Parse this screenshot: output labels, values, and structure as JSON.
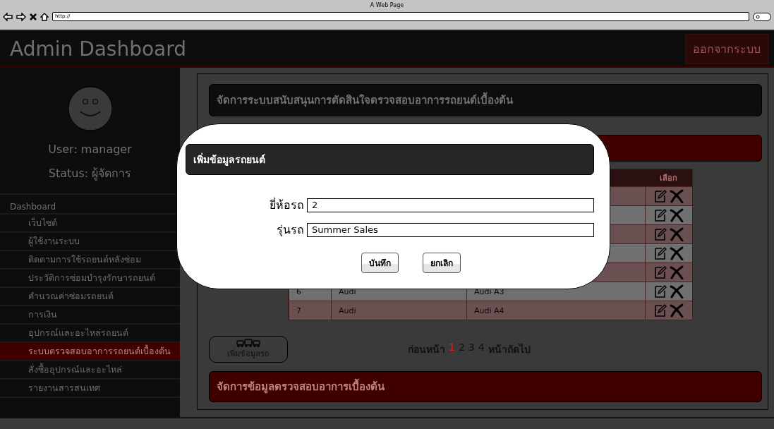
{
  "browser": {
    "title": "A Web Page",
    "url": "http://"
  },
  "header": {
    "title": "Admin Dashboard",
    "logout": "ออกจากระบบ"
  },
  "sidebar": {
    "user": "User: manager",
    "status": "Status: ผู้จัดการ",
    "section": "Dashboard",
    "items": [
      {
        "label": "เว็บไซต์",
        "selected": false
      },
      {
        "label": "ผู้ใช้งานระบบ",
        "selected": false
      },
      {
        "label": "ติดตามการใช้รถยนต์หลังซ่อม",
        "selected": false
      },
      {
        "label": "ประวัติการซ่อมบำรุงรักษารถยนต์",
        "selected": false
      },
      {
        "label": "คำนวณค่าซ่อมรถยนต์",
        "selected": false
      },
      {
        "label": "การเงิน",
        "selected": false
      },
      {
        "label": "อุปกรณ์และอะไหล่รถยนต์",
        "selected": false
      },
      {
        "label": "ระบบตรวจสอบอาการรถยนต์เบื้องต้น",
        "selected": true
      },
      {
        "label": "สั่งซื้ออุปกรณ์และอะไหล่",
        "selected": false
      },
      {
        "label": "รายงานสารสนเทศ",
        "selected": false
      }
    ]
  },
  "main": {
    "title": "จัดการระบบสนับสนุนการตัดสินใจตรวจสอบอาการรถยนต์เบื้องต้น",
    "table": {
      "action_column": "เลือก",
      "rows": [
        {
          "kind": "covered"
        },
        {
          "kind": "covered"
        },
        {
          "kind": "covered"
        },
        {
          "kind": "covered"
        },
        {
          "kind": "covered"
        },
        {
          "kind": "data",
          "no": "6",
          "brand": "Audi",
          "model": "Audi A3"
        },
        {
          "kind": "data",
          "no": "7",
          "brand": "Audi",
          "model": "Audi A4"
        }
      ]
    },
    "add_button": "เพิ่มข้อมูลรถ",
    "pagination": {
      "prev": "ก่อนหน้า",
      "pages": [
        {
          "label": "1",
          "selected": true
        },
        {
          "label": "2",
          "selected": false
        },
        {
          "label": "3",
          "selected": false
        },
        {
          "label": "4",
          "selected": false
        }
      ],
      "next": "หน้าถัดไป"
    },
    "footer_bar": "จัดการข้อมูลตรวจสอบอาการเบื้องต้น"
  },
  "dialog": {
    "title": "เพิ่มข้อมูลรถยนต์",
    "fields": [
      {
        "label": "ยี่ห้อรถ",
        "value": "2"
      },
      {
        "label": "รุ่นรถ",
        "value": "Summer Sales"
      }
    ],
    "buttons": [
      "บันทึก",
      "ยกเลิก"
    ]
  }
}
